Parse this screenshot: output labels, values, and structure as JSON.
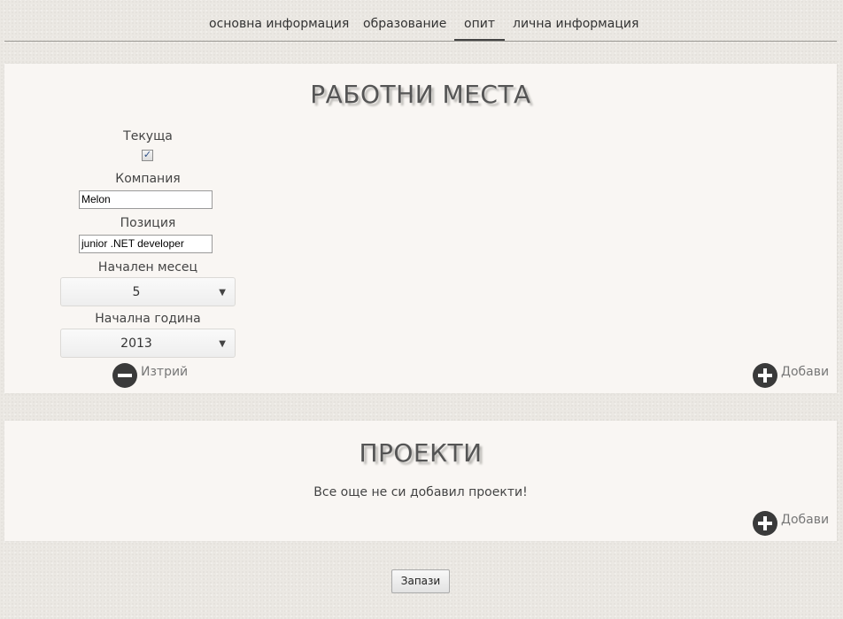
{
  "nav": {
    "tabs": [
      {
        "label": "основна информация"
      },
      {
        "label": "образование"
      },
      {
        "label": "опит",
        "active": true
      },
      {
        "label": "лична информация"
      }
    ]
  },
  "work": {
    "title": "РАБОТНИ МЕСТА",
    "jobs": [
      {
        "current_label": "Текуща",
        "current_checked": true,
        "company_label": "Компания",
        "company_value": "Melon",
        "position_label": "Позиция",
        "position_value": "junior .NET developer",
        "start_month_label": "Начален месец",
        "start_month_value": "5",
        "start_year_label": "Начална година",
        "start_year_value": "2013",
        "delete_label": "Изтрий"
      }
    ],
    "add_label": "Добави"
  },
  "projects": {
    "title": "ПРОЕКТИ",
    "empty_text": "Все още не си добавил проекти!",
    "add_label": "Добави"
  },
  "save_label": "Запази",
  "icons": {
    "add": "plus-circle-icon",
    "delete": "minus-circle-icon",
    "dropdown": "chevron-down-icon",
    "checkbox": "checkmark-icon"
  },
  "colors": {
    "background": "#ebe8e3",
    "panel": "#f9f6f3",
    "icon": "#3a3a3a"
  }
}
